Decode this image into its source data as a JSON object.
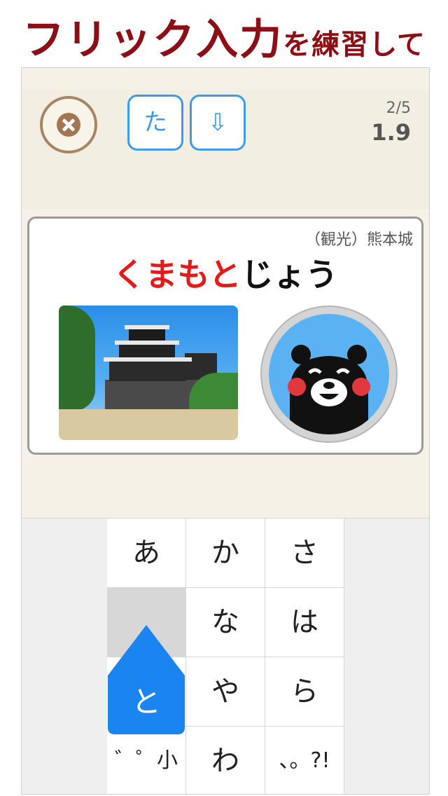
{
  "banner": {
    "title_large": "フリック入力",
    "title_small": "を練習して"
  },
  "toolbar": {
    "hint_kana": "た",
    "hint_down": "⇩"
  },
  "progress": {
    "count": "2/5",
    "time": "1.9"
  },
  "card": {
    "category": "（観光）熊本城",
    "reading_done": "くまもと",
    "reading_todo": "じょう"
  },
  "keyboard": {
    "keys": [
      "あ",
      "か",
      "さ",
      "",
      "な",
      "は",
      "",
      "や",
      "ら",
      "゛゜小",
      "わ",
      "、。?!"
    ],
    "flick_key": "と"
  },
  "colors": {
    "banner": "#8b0f14",
    "accent": "#3d9be8",
    "done_text": "#e31b1b",
    "flick": "#1a84f0",
    "close": "#a98463"
  }
}
